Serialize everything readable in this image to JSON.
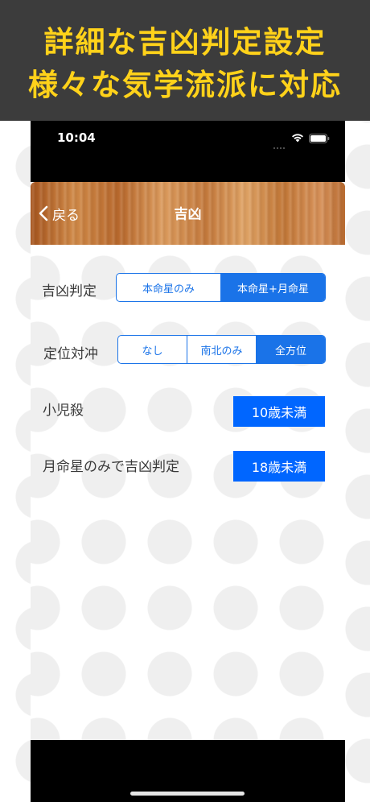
{
  "promo": {
    "line1": "詳細な吉凶判定設定",
    "line2": "様々な気学流派に対応"
  },
  "status_bar": {
    "time": "10:04"
  },
  "nav": {
    "back_label": "戻る",
    "title": "吉凶"
  },
  "settings": {
    "kikkyo_hantei": {
      "label": "吉凶判定",
      "options": [
        "本命星のみ",
        "本命星+月命星"
      ],
      "selected": "本命星+月命星"
    },
    "teii_taichu": {
      "label": "定位対冲",
      "options": [
        "なし",
        "南北のみ",
        "全方位"
      ],
      "selected": "全方位"
    },
    "shoni_satsu": {
      "label": "小児殺",
      "value": "10歳未満"
    },
    "getsumeisei_only": {
      "label": "月命星のみで吉凶判定",
      "value": "18歳未満"
    }
  },
  "colors": {
    "promo_background": "#3c3c3c",
    "promo_text": "#ffd21a",
    "accent": "#1a73e8",
    "value_button": "#0066ff"
  }
}
